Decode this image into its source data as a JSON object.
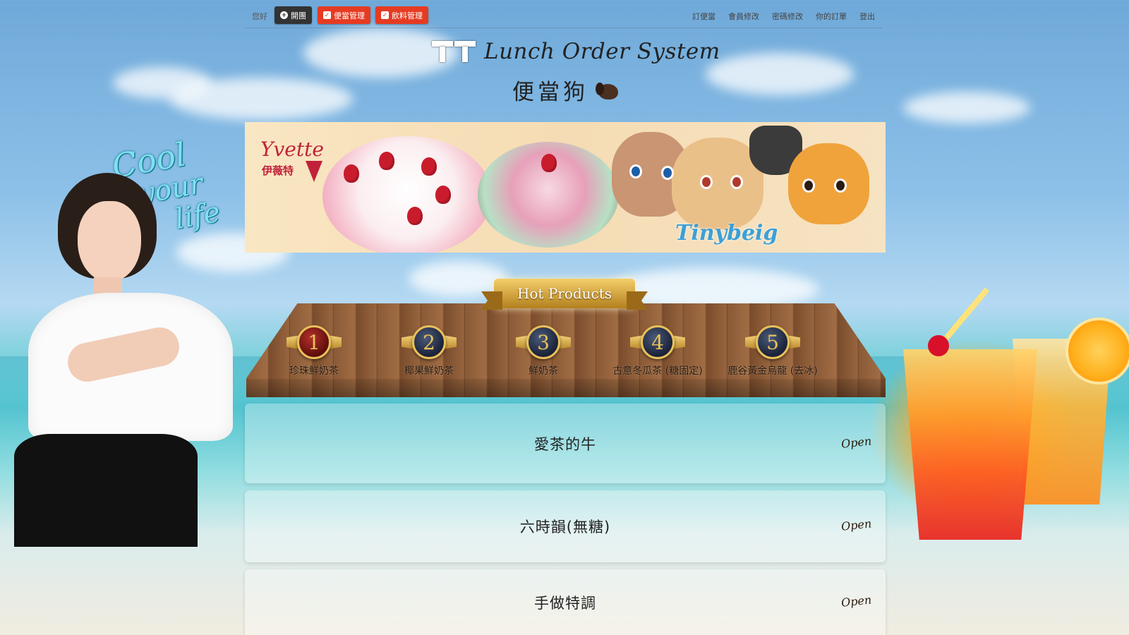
{
  "nav": {
    "greeting": "您好",
    "buttons": [
      {
        "label": "開團",
        "icon": "plus-circle-icon"
      },
      {
        "label": "便當管理",
        "icon": "check-square-icon"
      },
      {
        "label": "飲料管理",
        "icon": "check-square-icon"
      }
    ],
    "links": [
      "訂便當",
      "會員修改",
      "密碼修改",
      "你的訂單",
      "登出"
    ]
  },
  "header": {
    "title": "Lunch Order System",
    "subtitle": "便當狗",
    "logo_icon": "tt-logo-icon",
    "subtitle_icon": "dog-icon"
  },
  "banner": {
    "brand": "Yvette",
    "brand_zh": "伊薇特",
    "tag": "Tinybeig"
  },
  "promo": {
    "cool_words": [
      "Cool",
      "your",
      "life"
    ]
  },
  "hot_products": {
    "title": "Hot Products",
    "items": [
      {
        "rank": "1",
        "name": "珍珠鮮奶茶"
      },
      {
        "rank": "2",
        "name": "椰果鮮奶茶"
      },
      {
        "rank": "3",
        "name": "鮮奶茶"
      },
      {
        "rank": "4",
        "name": "古意冬瓜茶 (糖固定)"
      },
      {
        "rank": "5",
        "name": "鹿谷黃金烏龍 (去冰)"
      }
    ]
  },
  "shops": [
    {
      "name": "愛茶的牛",
      "status": "Open"
    },
    {
      "name": "六時韻(無糖)",
      "status": "Open"
    },
    {
      "name": "手做特調",
      "status": "Open"
    }
  ]
}
